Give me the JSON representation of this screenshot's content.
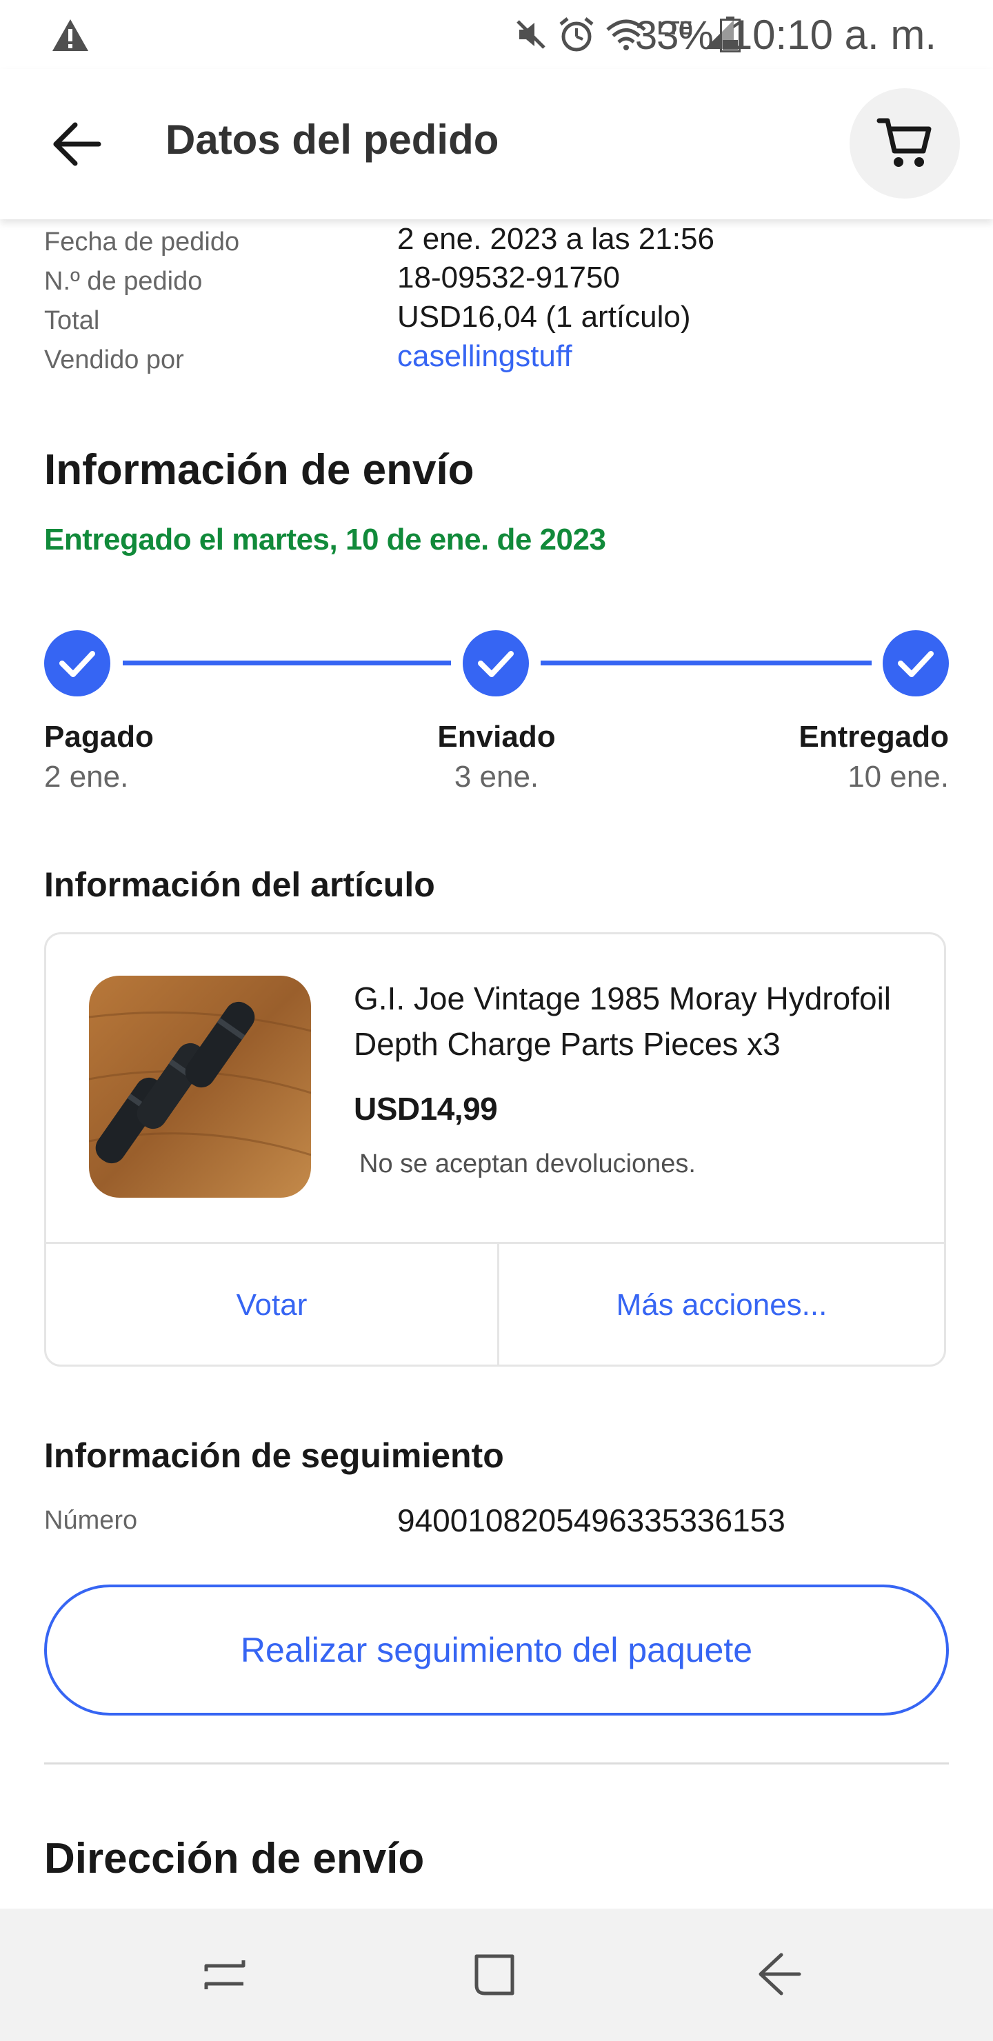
{
  "status_bar": {
    "battery": "33%",
    "time": "10:10 a. m.",
    "network": "LTE",
    "icons": [
      "warning-icon",
      "mute-icon",
      "alarm-icon",
      "wifi-icon",
      "lte-icon",
      "signal-icon",
      "battery-icon"
    ],
    "battery_level": 0.33
  },
  "app_bar": {
    "title": "Datos del pedido",
    "icons": [
      "back-arrow-icon",
      "cart-icon"
    ]
  },
  "order": {
    "rows": [
      {
        "label": "Fecha de pedido",
        "value": "2 ene. 2023 a las 21:56"
      },
      {
        "label": "N.º de pedido",
        "value": "18-09532-91750"
      },
      {
        "label": "Total",
        "value": "USD16,04 (1 artículo)"
      },
      {
        "label": "Vendido por",
        "value": "casellingstuff"
      }
    ]
  },
  "shipping": {
    "title": "Información de envío",
    "status": "Entregado el martes, 10 de ene. de 2023",
    "steps": [
      {
        "label": "Pagado",
        "date": "2 ene."
      },
      {
        "label": "Enviado",
        "date": "3 ene."
      },
      {
        "label": "Entregado",
        "date": "10 ene."
      }
    ]
  },
  "item": {
    "section_title": "Información del artículo",
    "title": "G.I. Joe Vintage 1985 Moray Hydrofoil Depth Charge Parts Pieces x3",
    "price": "USD14,99",
    "returns": "No se aceptan devoluciones.",
    "actions": {
      "vote": "Votar",
      "more": "Más acciones..."
    }
  },
  "tracking": {
    "section_title": "Información de seguimiento",
    "number_label": "Número",
    "number": "9400108205496335336153",
    "button": "Realizar seguimiento del paquete"
  },
  "address": {
    "section_title": "Dirección de envío"
  },
  "nav_bar": {
    "icons": [
      "recent-apps-icon",
      "home-icon",
      "back-icon"
    ]
  },
  "colors": {
    "accent": "#3665f3",
    "success": "#118a3a",
    "text": "#191919",
    "muted": "#666666"
  }
}
